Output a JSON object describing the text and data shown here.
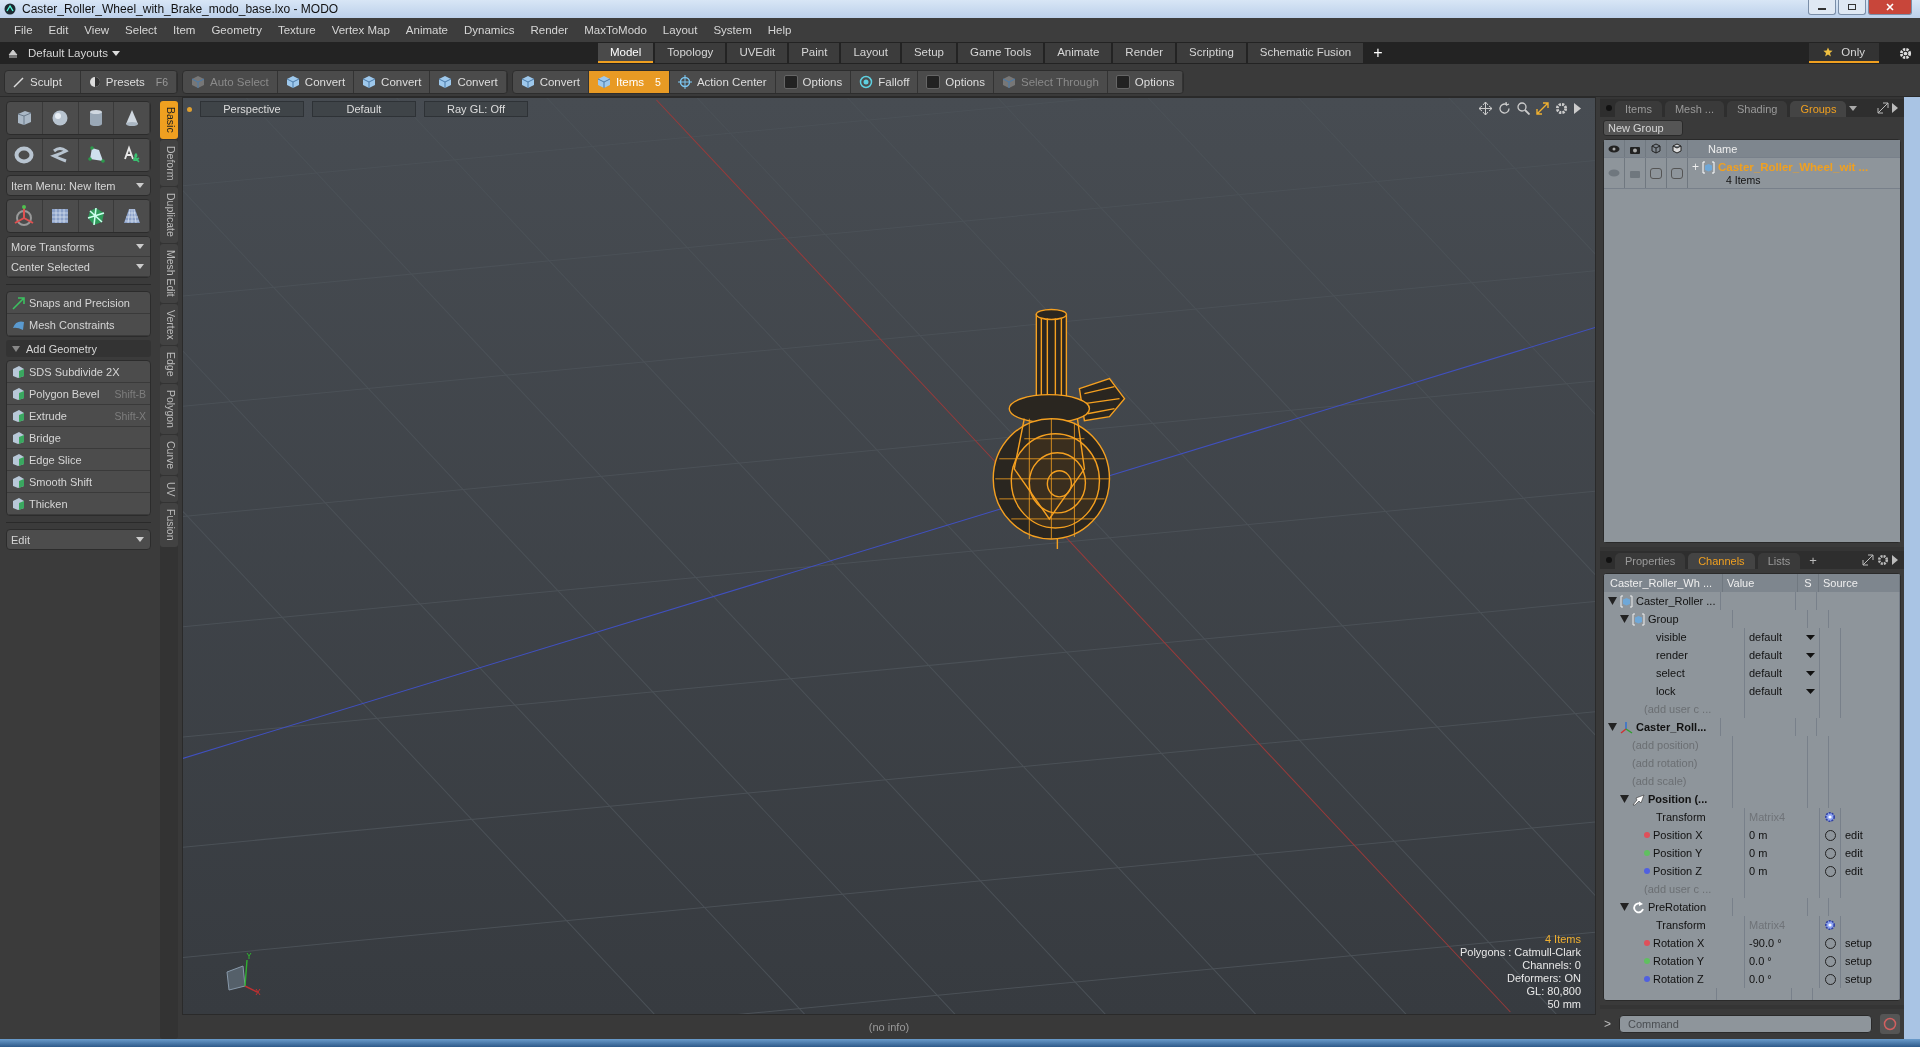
{
  "window": {
    "title": "Caster_Roller_Wheel_with_Brake_modo_base.lxo - MODO"
  },
  "menu_bar": [
    "File",
    "Edit",
    "View",
    "Select",
    "Item",
    "Geometry",
    "Texture",
    "Vertex Map",
    "Animate",
    "Dynamics",
    "Render",
    "MaxToModo",
    "Layout",
    "System",
    "Help"
  ],
  "layout_bar": {
    "layout_menu": "Default Layouts",
    "tabs": [
      {
        "label": "Model",
        "selected": true
      },
      {
        "label": "Topology",
        "selected": false
      },
      {
        "label": "UVEdit",
        "selected": false
      },
      {
        "label": "Paint",
        "selected": false
      },
      {
        "label": "Layout",
        "selected": false
      },
      {
        "label": "Setup",
        "selected": false
      },
      {
        "label": "Game Tools",
        "selected": false
      },
      {
        "label": "Animate",
        "selected": false
      },
      {
        "label": "Render",
        "selected": false
      },
      {
        "label": "Scripting",
        "selected": false
      },
      {
        "label": "Schematic Fusion",
        "selected": false
      }
    ],
    "add_tab": "+",
    "only": "Only"
  },
  "toolbar": {
    "sculpt": "Sculpt",
    "presets": "Presets",
    "presets_key": "F6",
    "groups": [
      {
        "items": [
          {
            "label": "Auto Select",
            "kind": "tool",
            "selected": false,
            "disabled": true
          },
          {
            "label": "Convert",
            "kind": "tool",
            "selected": false,
            "disabled": false
          },
          {
            "label": "Convert",
            "kind": "tool",
            "selected": false,
            "disabled": false
          },
          {
            "label": "Convert",
            "kind": "tool",
            "selected": false,
            "disabled": false
          }
        ]
      },
      {
        "items": [
          {
            "label": "Convert",
            "kind": "tool",
            "selected": false,
            "disabled": false
          },
          {
            "label": "Items",
            "kind": "tool",
            "selected": true,
            "disabled": false,
            "shortcut": "5"
          },
          {
            "label": "Action Center",
            "kind": "target",
            "selected": false,
            "disabled": false
          },
          {
            "label": "Options",
            "kind": "check",
            "selected": false,
            "disabled": false
          },
          {
            "label": "Falloff",
            "kind": "falloff",
            "selected": false,
            "disabled": false
          },
          {
            "label": "Options",
            "kind": "check",
            "selected": false,
            "disabled": false
          },
          {
            "label": "Select Through",
            "kind": "tool",
            "selected": false,
            "disabled": true
          },
          {
            "label": "Options",
            "kind": "check",
            "selected": false,
            "disabled": false
          }
        ]
      }
    ]
  },
  "left_panel": {
    "item_menu": "Item Menu: New Item",
    "transform_menus": [
      "More Transforms",
      "Center Selected"
    ],
    "helpers": [
      "Snaps and Precision",
      "Mesh Constraints"
    ],
    "section": {
      "label": "Add Geometry",
      "expanded": true
    },
    "geometry_tools": [
      {
        "label": "SDS Subdivide 2X"
      },
      {
        "label": "Polygon Bevel",
        "shortcut": "Shift-B"
      },
      {
        "label": "Extrude",
        "shortcut": "Shift-X"
      },
      {
        "label": "Bridge"
      },
      {
        "label": "Edge Slice"
      },
      {
        "label": "Smooth Shift"
      },
      {
        "label": "Thicken"
      }
    ],
    "edit_menu": "Edit",
    "side_tabs": [
      {
        "label": "Basic",
        "selected": true
      },
      {
        "label": "Deform",
        "selected": false
      },
      {
        "label": "Duplicate",
        "selected": false
      },
      {
        "label": "Mesh Edit",
        "selected": false
      },
      {
        "label": "Vertex",
        "selected": false
      },
      {
        "label": "Edge",
        "selected": false
      },
      {
        "label": "Polygon",
        "selected": false
      },
      {
        "label": "Curve",
        "selected": false
      },
      {
        "label": "UV",
        "selected": false
      },
      {
        "label": "Fusion",
        "selected": false
      }
    ]
  },
  "viewport": {
    "header": [
      "Perspective",
      "Default",
      "Ray GL: Off"
    ],
    "info": [
      {
        "text": "4 Items",
        "kind": "count"
      },
      {
        "text": "Polygons : Catmull-Clark",
        "kind": "stat"
      },
      {
        "text": "Channels: 0",
        "kind": "stat"
      },
      {
        "text": "Deformers: ON",
        "kind": "stat"
      },
      {
        "text": "GL: 80,800",
        "kind": "stat"
      },
      {
        "text": "50 mm",
        "kind": "stat"
      }
    ]
  },
  "status_bar": {
    "text": "(no info)"
  },
  "groups_panel": {
    "tabs": [
      {
        "label": "Items",
        "selected": false
      },
      {
        "label": "Mesh ...",
        "selected": false
      },
      {
        "label": "Shading",
        "selected": false
      },
      {
        "label": "Groups",
        "selected": true
      }
    ],
    "new_group": "New Group",
    "name_column": "Name",
    "rows": [
      {
        "name": "Caster_Roller_Wheel_wit ...",
        "count": "4 Items",
        "expander": "+"
      }
    ]
  },
  "channels_panel": {
    "tabs": [
      {
        "label": "Properties",
        "selected": false
      },
      {
        "label": "Channels",
        "selected": true
      },
      {
        "label": "Lists",
        "selected": false
      }
    ],
    "add_tab": "+",
    "columns": [
      "Caster_Roller_Wh ...",
      "Value",
      "S",
      "Source"
    ],
    "tree": [
      {
        "name": "Caster_Roller ...",
        "kind": "mesh",
        "expanded": true,
        "children": [
          {
            "name": "Group",
            "kind": "group",
            "expanded": true,
            "children": [
              {
                "name": "visible",
                "kind": "option",
                "value": "default"
              },
              {
                "name": "render",
                "kind": "option",
                "value": "default"
              },
              {
                "name": "select",
                "kind": "option",
                "value": "default"
              },
              {
                "name": "lock",
                "kind": "option",
                "value": "default"
              },
              {
                "name": "(add user c ...",
                "kind": "add"
              }
            ]
          }
        ]
      },
      {
        "name": "Caster_Roll...",
        "kind": "locator",
        "expanded": true,
        "children": [
          {
            "name": "(add position)",
            "kind": "add"
          },
          {
            "name": "(add rotation)",
            "kind": "add"
          },
          {
            "name": "(add scale)",
            "kind": "add"
          },
          {
            "name": "Position (...",
            "kind": "transform",
            "expanded": true,
            "children": [
              {
                "name": "Transform",
                "kind": "matrix",
                "value": "Matrix4"
              },
              {
                "name": "Position X",
                "kind": "channel",
                "value": "0 m",
                "source": "edit",
                "color": "#e0505a"
              },
              {
                "name": "Position Y",
                "kind": "channel",
                "value": "0 m",
                "source": "edit",
                "color": "#60c060"
              },
              {
                "name": "Position Z",
                "kind": "channel",
                "value": "0 m",
                "source": "edit",
                "color": "#5060e0"
              },
              {
                "name": "(add user c ...",
                "kind": "add"
              }
            ]
          },
          {
            "name": "PreRotation",
            "kind": "rotation",
            "expanded": true,
            "children": [
              {
                "name": "Transform",
                "kind": "matrix",
                "value": "Matrix4"
              },
              {
                "name": "Rotation X",
                "kind": "channel",
                "value": "-90.0 °",
                "source": "setup",
                "color": "#e0505a"
              },
              {
                "name": "Rotation Y",
                "kind": "channel",
                "value": "0.0 °",
                "source": "setup",
                "color": "#60c060"
              },
              {
                "name": "Rotation Z",
                "kind": "channel",
                "value": "0.0 °",
                "source": "setup",
                "color": "#5060e0"
              }
            ]
          }
        ]
      }
    ]
  },
  "command_bar": {
    "prompt": ">",
    "placeholder": "Command"
  }
}
